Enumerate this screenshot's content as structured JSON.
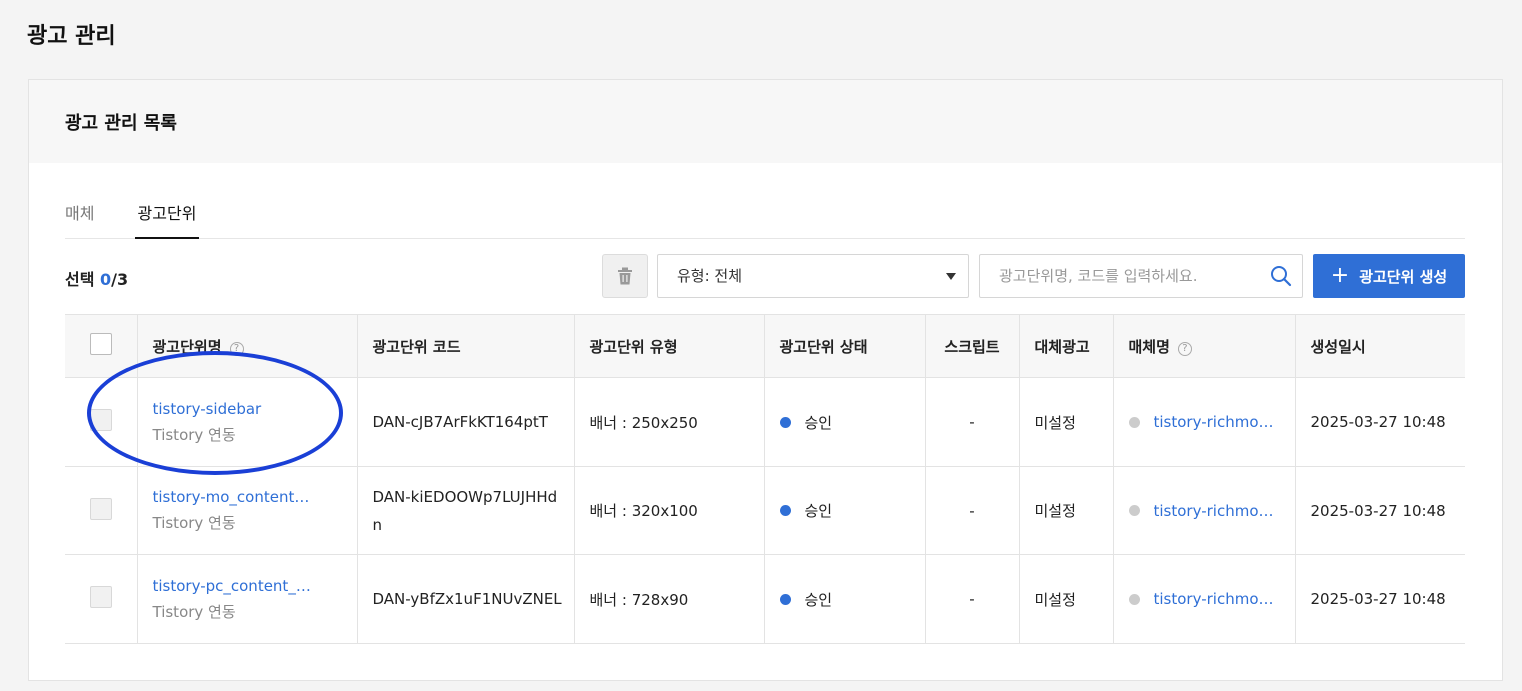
{
  "page": {
    "title": "광고 관리"
  },
  "card": {
    "title": "광고 관리 목록"
  },
  "tabs": [
    {
      "label": "매체"
    },
    {
      "label": "광고단위"
    }
  ],
  "toolbar": {
    "selected_label": "선택",
    "selected_count": "0",
    "total_count": "/3",
    "type_filter_value": "유형: 전체",
    "search_placeholder": "광고단위명, 코드를 입력하세요.",
    "create_label": "광고단위 생성"
  },
  "table": {
    "headers": {
      "name": "광고단위명",
      "code": "광고단위 코드",
      "type": "광고단위 유형",
      "status": "광고단위 상태",
      "script": "스크립트",
      "fallback": "대체광고",
      "media": "매체명",
      "created": "생성일시"
    },
    "rows": [
      {
        "name": "tistory-sidebar",
        "sub": "Tistory 연동",
        "code": "DAN-cJB7ArFkKT164ptT",
        "type": "배너 : 250x250",
        "status": "승인",
        "script": "-",
        "fallback": "미설정",
        "media": "tistory-richmo…",
        "created": "2025-03-27 10:48"
      },
      {
        "name": "tistory-mo_content…",
        "sub": "Tistory 연동",
        "code": "DAN-kiEDOOWp7LUJHHdn",
        "type": "배너 : 320x100",
        "status": "승인",
        "script": "-",
        "fallback": "미설정",
        "media": "tistory-richmo…",
        "created": "2025-03-27 10:48"
      },
      {
        "name": "tistory-pc_content_…",
        "sub": "Tistory 연동",
        "code": "DAN-yBfZx1uF1NUvZNEL",
        "type": "배너 : 728x90",
        "status": "승인",
        "script": "-",
        "fallback": "미설정",
        "media": "tistory-richmo…",
        "created": "2025-03-27 10:48"
      }
    ]
  },
  "colors": {
    "accent": "#2f6fd6",
    "status_approved": "#2f6fd6",
    "media_dot": "#cccccc",
    "annotation": "#1a3fd6"
  }
}
